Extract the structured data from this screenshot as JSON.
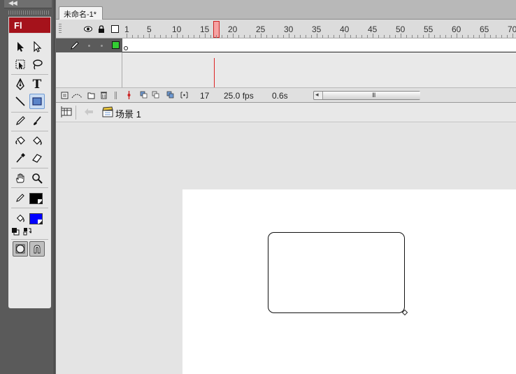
{
  "app": {
    "logo": "Fl"
  },
  "document": {
    "tab_title": "未命名-1*"
  },
  "timeline": {
    "ruler_labels": [
      "1",
      "5",
      "10",
      "15",
      "20",
      "25",
      "30",
      "35",
      "40",
      "45",
      "50",
      "55",
      "60",
      "65",
      "70"
    ],
    "current_frame": "17",
    "frame_rate": "25.0 fps",
    "elapsed_time": "0.6s",
    "scroll_grip": "III"
  },
  "edit_bar": {
    "scene": "场景 1"
  },
  "colors": {
    "stroke_color": "#000000",
    "fill_color": "#0000ff",
    "layer_color": "#33cc33",
    "accent_red": "#a5121b"
  },
  "tools": [
    "selection",
    "subselection",
    "free-transform",
    "lasso",
    "pen",
    "text",
    "line",
    "rectangle",
    "pencil",
    "brush",
    "ink-bottle",
    "paint-bucket",
    "eyedropper",
    "eraser",
    "hand",
    "zoom",
    "stroke-color",
    "fill-color",
    "black-white",
    "swap-colors",
    "object-drawing",
    "snap-to-objects"
  ],
  "selected_tool": "rectangle"
}
